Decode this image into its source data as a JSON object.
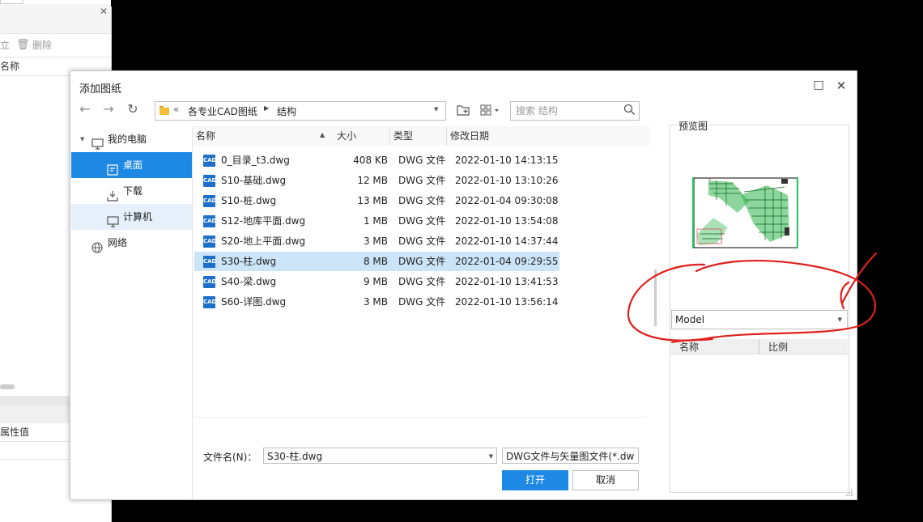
{
  "bg": {
    "toolbar_item1": "立",
    "delete_label": "删除",
    "col_name": "名称",
    "prop_value": "属性值"
  },
  "dialog": {
    "title": "添加图纸",
    "breadcrumb": [
      "各专业CAD图纸",
      "结构"
    ],
    "search_placeholder": "搜索 结构",
    "nav": {
      "computer": "我的电脑",
      "desktop": "桌面",
      "downloads": "下载",
      "pc": "计算机",
      "network": "网络"
    },
    "columns": {
      "name": "名称",
      "size": "大小",
      "type": "类型",
      "date": "修改日期"
    },
    "files": [
      {
        "name": "0_目录_t3.dwg",
        "size": "408 KB",
        "type": "DWG 文件",
        "date": "2022-01-10 14:13:15"
      },
      {
        "name": "S10-基础.dwg",
        "size": "12 MB",
        "type": "DWG 文件",
        "date": "2022-01-10 13:10:26"
      },
      {
        "name": "S10-桩.dwg",
        "size": "13 MB",
        "type": "DWG 文件",
        "date": "2022-01-04 09:30:08"
      },
      {
        "name": "S12-地库平面.dwg",
        "size": "1 MB",
        "type": "DWG 文件",
        "date": "2022-01-10 13:54:08"
      },
      {
        "name": "S20-地上平面.dwg",
        "size": "3 MB",
        "type": "DWG 文件",
        "date": "2022-01-10 14:37:44"
      },
      {
        "name": "S30-柱.dwg",
        "size": "8 MB",
        "type": "DWG 文件",
        "date": "2022-01-04 09:29:55"
      },
      {
        "name": "S40-梁.dwg",
        "size": "9 MB",
        "type": "DWG 文件",
        "date": "2022-01-10 13:41:53"
      },
      {
        "name": "S60-详图.dwg",
        "size": "3 MB",
        "type": "DWG 文件",
        "date": "2022-01-10 13:56:14"
      }
    ],
    "selected_index": 5,
    "filename_label": "文件名(N)：",
    "filename_value": "S30-柱.dwg",
    "filetype_value": "DWG文件与矢量图文件(*.dw",
    "open_label": "打开",
    "cancel_label": "取消",
    "preview": {
      "label": "预览图",
      "layout_value": "Model",
      "col_name": "名称",
      "col_scale": "比例"
    }
  },
  "colors": {
    "selection": "#cce4f7",
    "accent": "#1e88e5",
    "annotation": "#e0201c"
  }
}
